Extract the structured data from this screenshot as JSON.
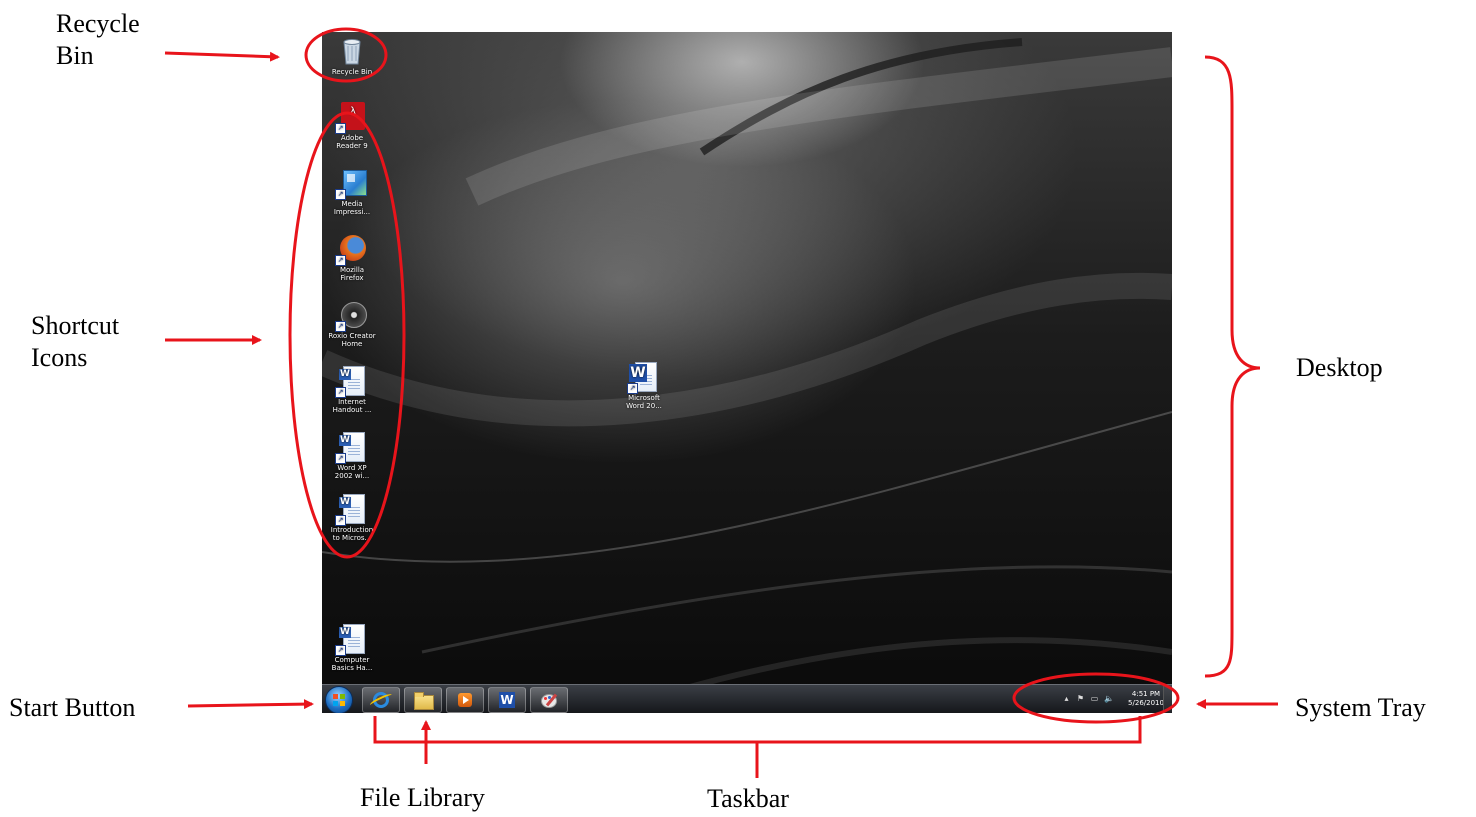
{
  "annotations": {
    "recycle_bin": "Recycle\nBin",
    "shortcut_icons": "Shortcut\nIcons",
    "start_button": "Start Button",
    "file_library": "File Library",
    "taskbar": "Taskbar",
    "desktop": "Desktop",
    "system_tray": "System Tray"
  },
  "colors": {
    "annotation_red": "#e8141b",
    "taskbar": "#1f2226"
  },
  "desktop": {
    "icons": {
      "recycle_bin": "Recycle Bin",
      "adobe_reader": "Adobe\nReader 9",
      "media_impression": "Media\nImpressi...",
      "firefox": "Mozilla\nFirefox",
      "roxio": "Roxio Creator\nHome",
      "internet_handout": "Internet\nHandout ...",
      "word_xp": "Word XP\n2002 wi...",
      "introduction": "Introduction\nto Micros...",
      "computer_basics": "Computer\nBasics Ha...",
      "microsoft_word": "Microsoft\nWord 20..."
    }
  },
  "taskbar": {
    "pinned": [
      "internet-explorer-icon",
      "file-library-icon",
      "media-player-icon",
      "word-icon",
      "paint-icon"
    ],
    "tray": {
      "time": "4:51 PM",
      "date": "5/26/2010"
    }
  }
}
